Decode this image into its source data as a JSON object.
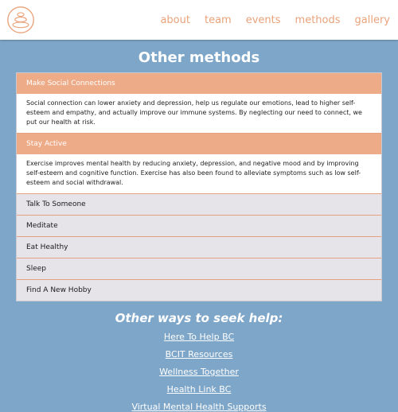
{
  "nav": {
    "items": [
      "about",
      "team",
      "events",
      "methods",
      "gallery"
    ]
  },
  "methods": {
    "title": "Other methods",
    "items": [
      {
        "label": "Make Social Connections",
        "open": true,
        "body": "Social connection can lower anxiety and depression, help us regulate our emotions, lead to higher self-esteem and empathy, and actually improve our immune systems. By neglecting our need to connect, we put our health at risk."
      },
      {
        "label": "Stay Active",
        "open": true,
        "body": "Exercise improves mental health by reducing anxiety, depression, and negative mood and by improving self-esteem and cognitive function. Exercise has also been found to alleviate symptoms such as low self-esteem and social withdrawal."
      },
      {
        "label": "Talk To Someone",
        "open": false
      },
      {
        "label": "Meditate",
        "open": false
      },
      {
        "label": "Eat Healthy",
        "open": false
      },
      {
        "label": "Sleep",
        "open": false
      },
      {
        "label": "Find A New Hobby",
        "open": false
      }
    ]
  },
  "help": {
    "title": "Other ways to seek help:",
    "links": [
      "Here To Help BC",
      "BCIT Resources",
      "Wellness Together",
      "Health Link BC",
      "Virtual Mental Health Supports"
    ]
  },
  "colors": {
    "accent": "#eeab88",
    "background": "#7ea6c9",
    "nav_text": "#e9a27a",
    "accordion_bg": "#e6e3e9"
  },
  "icons": {
    "logo": "stacked-stones-logo-icon"
  }
}
